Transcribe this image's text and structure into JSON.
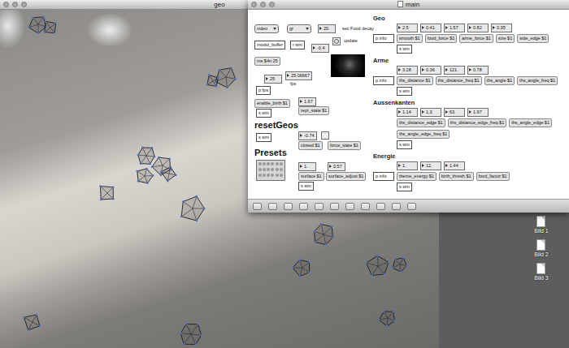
{
  "geo_window": {
    "title": "geo"
  },
  "main_window": {
    "title": "main",
    "left_objects": [
      {
        "kind": "menu",
        "text": "video"
      },
      {
        "kind": "menu",
        "text": "gr"
      },
      {
        "kind": "number",
        "text": "20."
      },
      {
        "kind": "comment",
        "text": "sec Food decay"
      },
      {
        "kind": "object",
        "text": "modul_buffer"
      },
      {
        "kind": "object",
        "text": "r sim"
      },
      {
        "kind": "number",
        "text": "-0.4"
      },
      {
        "kind": "bang"
      },
      {
        "kind": "comment",
        "text": "update"
      },
      {
        "kind": "pwindow"
      },
      {
        "kind": "message",
        "text": "ms $4n 25"
      },
      {
        "kind": "number",
        "text": "25"
      },
      {
        "kind": "number",
        "text": "25.06667"
      },
      {
        "kind": "comment",
        "text": "fps"
      },
      {
        "kind": "object",
        "text": "p fps"
      },
      {
        "kind": "message",
        "text": "enable_birth $1"
      },
      {
        "kind": "number",
        "text": "1.67"
      },
      {
        "kind": "message",
        "text": "repr_state $1"
      },
      {
        "kind": "object",
        "text": "s sim"
      },
      {
        "kind": "heading",
        "text": "resetGeos"
      },
      {
        "kind": "object",
        "text": "s sim"
      },
      {
        "kind": "number",
        "text": "-0.74"
      },
      {
        "kind": "toggle",
        "checked": false
      },
      {
        "kind": "message",
        "text": "closed $1"
      },
      {
        "kind": "message",
        "text": "force_state $1"
      },
      {
        "kind": "heading",
        "text": "Presets"
      },
      {
        "kind": "preset"
      },
      {
        "kind": "number",
        "text": "1."
      },
      {
        "kind": "number",
        "text": "0.57"
      },
      {
        "kind": "message",
        "text": "surface $1"
      },
      {
        "kind": "message",
        "text": "surface_adjust $1"
      },
      {
        "kind": "object",
        "text": "s sim"
      }
    ],
    "sections": [
      {
        "title": "Geo",
        "info": "p info",
        "numbers": [
          "2.5",
          "0.41",
          "1.57",
          "0.82",
          "0.35"
        ],
        "messages": [
          "smooth $1",
          "food_force $1",
          "arme_force $1",
          "size $1",
          "side_edge $1"
        ],
        "send": "s sim"
      },
      {
        "title": "Arme",
        "info": "p info",
        "numbers": [
          "3.28",
          "0.36",
          "121.",
          "0.78"
        ],
        "messages": [
          "ths_distance $1",
          "ths_distance_freq $1",
          "ths_angle $1",
          "ths_angle_freq $1"
        ],
        "send": "s sim"
      },
      {
        "title": "Aussenkanten",
        "numbers": [
          "1.14",
          "1.3",
          "63.",
          "1.97"
        ],
        "messages": [
          "ths_distance_edge $1",
          "ths_distance_edge_freq $1",
          "ths_angle_edge $1",
          "ths_angle_edge_freq $1"
        ],
        "send": "s sim"
      },
      {
        "title": "Energie",
        "info": "p info",
        "numbers": [
          "1.",
          "12.",
          "1.44"
        ],
        "messages": [
          "theme_energy $1",
          "birth_thresh $1",
          "food_factor $1"
        ],
        "send": "s sim"
      }
    ]
  },
  "desktop": {
    "items": [
      {
        "label": "Bild 1"
      },
      {
        "label": "Bild 2"
      },
      {
        "label": "Bild 3"
      }
    ]
  }
}
